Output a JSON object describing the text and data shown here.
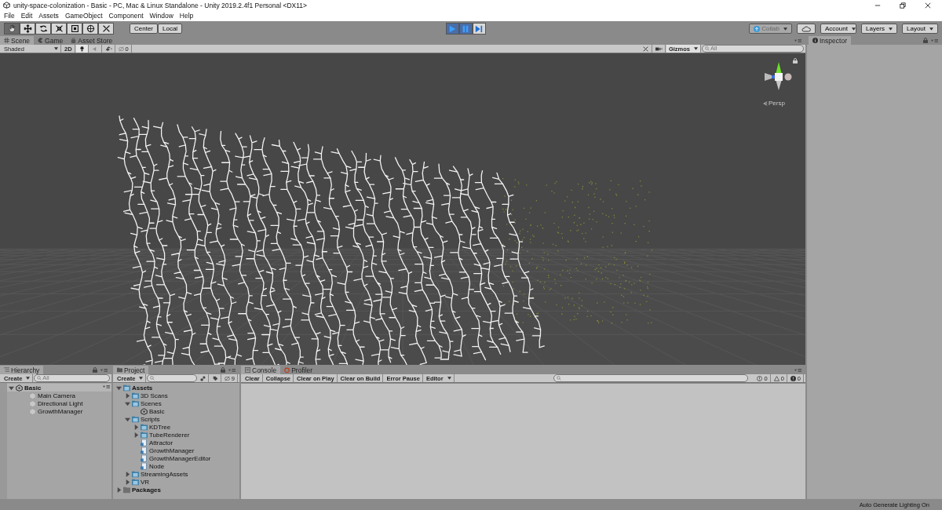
{
  "window": {
    "title": "unity-space-colonization - Basic - PC, Mac & Linux Standalone - Unity 2019.2.4f1 Personal <DX11>"
  },
  "menu": [
    "File",
    "Edit",
    "Assets",
    "GameObject",
    "Component",
    "Window",
    "Help"
  ],
  "toolbar": {
    "tools": [
      {
        "kind": "hand",
        "selected": true
      },
      {
        "kind": "move",
        "selected": false
      },
      {
        "kind": "rotate",
        "selected": false
      },
      {
        "kind": "scale",
        "selected": false
      },
      {
        "kind": "rect",
        "selected": false
      },
      {
        "kind": "transform",
        "selected": false
      },
      {
        "kind": "custom",
        "selected": false
      }
    ],
    "pivot": [
      "Center",
      "Local"
    ],
    "playback": [
      {
        "kind": "play",
        "selected": true
      },
      {
        "kind": "pause",
        "selected": true
      },
      {
        "kind": "step",
        "selected": false
      }
    ],
    "collab": "Collab",
    "account": "Account",
    "layers": "Layers",
    "layout": "Layout"
  },
  "scene": {
    "tabs": [
      {
        "label": "Scene",
        "kind": "scene",
        "selected": true
      },
      {
        "label": "Game",
        "kind": "game",
        "selected": false
      },
      {
        "label": "Asset Store",
        "kind": "store",
        "selected": false
      }
    ],
    "shading": "Shaded",
    "mode_2d": "2D",
    "toggles": [
      {
        "kind": "lighting",
        "on": true
      },
      {
        "kind": "audio",
        "on": false
      }
    ],
    "hidden_count": "0",
    "tools_on": false,
    "gizmos": "Gizmos",
    "search": {
      "placeholder": "All"
    },
    "projection": "Persp"
  },
  "inspector": {
    "tab": "Inspector"
  },
  "hierarchy": {
    "tab": "Hierarchy",
    "create": "Create",
    "search": {
      "placeholder": "All"
    },
    "scene": {
      "name": "Basic",
      "expanded": true,
      "children": [
        {
          "name": "Main Camera"
        },
        {
          "name": "Directional Light"
        },
        {
          "name": "GrowthManager"
        }
      ]
    }
  },
  "project": {
    "tab": "Project",
    "create": "Create",
    "hidden_count": "9",
    "tree": [
      {
        "name": "Assets",
        "kind": "folder",
        "expanded": true,
        "children": [
          {
            "name": "3D Scans",
            "kind": "folder",
            "expanded": false
          },
          {
            "name": "Scenes",
            "kind": "folder",
            "expanded": true,
            "children": [
              {
                "name": "Basic",
                "kind": "scene"
              }
            ]
          },
          {
            "name": "Scripts",
            "kind": "folder",
            "expanded": true,
            "children": [
              {
                "name": "KDTree",
                "kind": "folder",
                "expanded": false
              },
              {
                "name": "TubeRenderer",
                "kind": "folder",
                "expanded": false
              },
              {
                "name": "Attractor",
                "kind": "script"
              },
              {
                "name": "GrowthManager",
                "kind": "script"
              },
              {
                "name": "GrowthManagerEditor",
                "kind": "script"
              },
              {
                "name": "Node",
                "kind": "script"
              }
            ]
          },
          {
            "name": "StreamingAssets",
            "kind": "folder",
            "expanded": false
          },
          {
            "name": "VR",
            "kind": "folder",
            "expanded": false
          }
        ]
      },
      {
        "name": "Packages",
        "kind": "package",
        "expanded": false
      }
    ]
  },
  "console": {
    "tabs": [
      {
        "label": "Console",
        "kind": "console",
        "selected": true
      },
      {
        "label": "Profiler",
        "kind": "profiler",
        "selected": false
      }
    ],
    "buttons": [
      "Clear",
      "Collapse",
      "Clear on Play",
      "Clear on Build",
      "Error Pause"
    ],
    "filter": "Editor",
    "counts": [
      {
        "kind": "info",
        "count": "0"
      },
      {
        "kind": "warning",
        "count": "0"
      },
      {
        "kind": "error",
        "count": "0"
      }
    ]
  },
  "status": "Auto Generate Lighting On"
}
